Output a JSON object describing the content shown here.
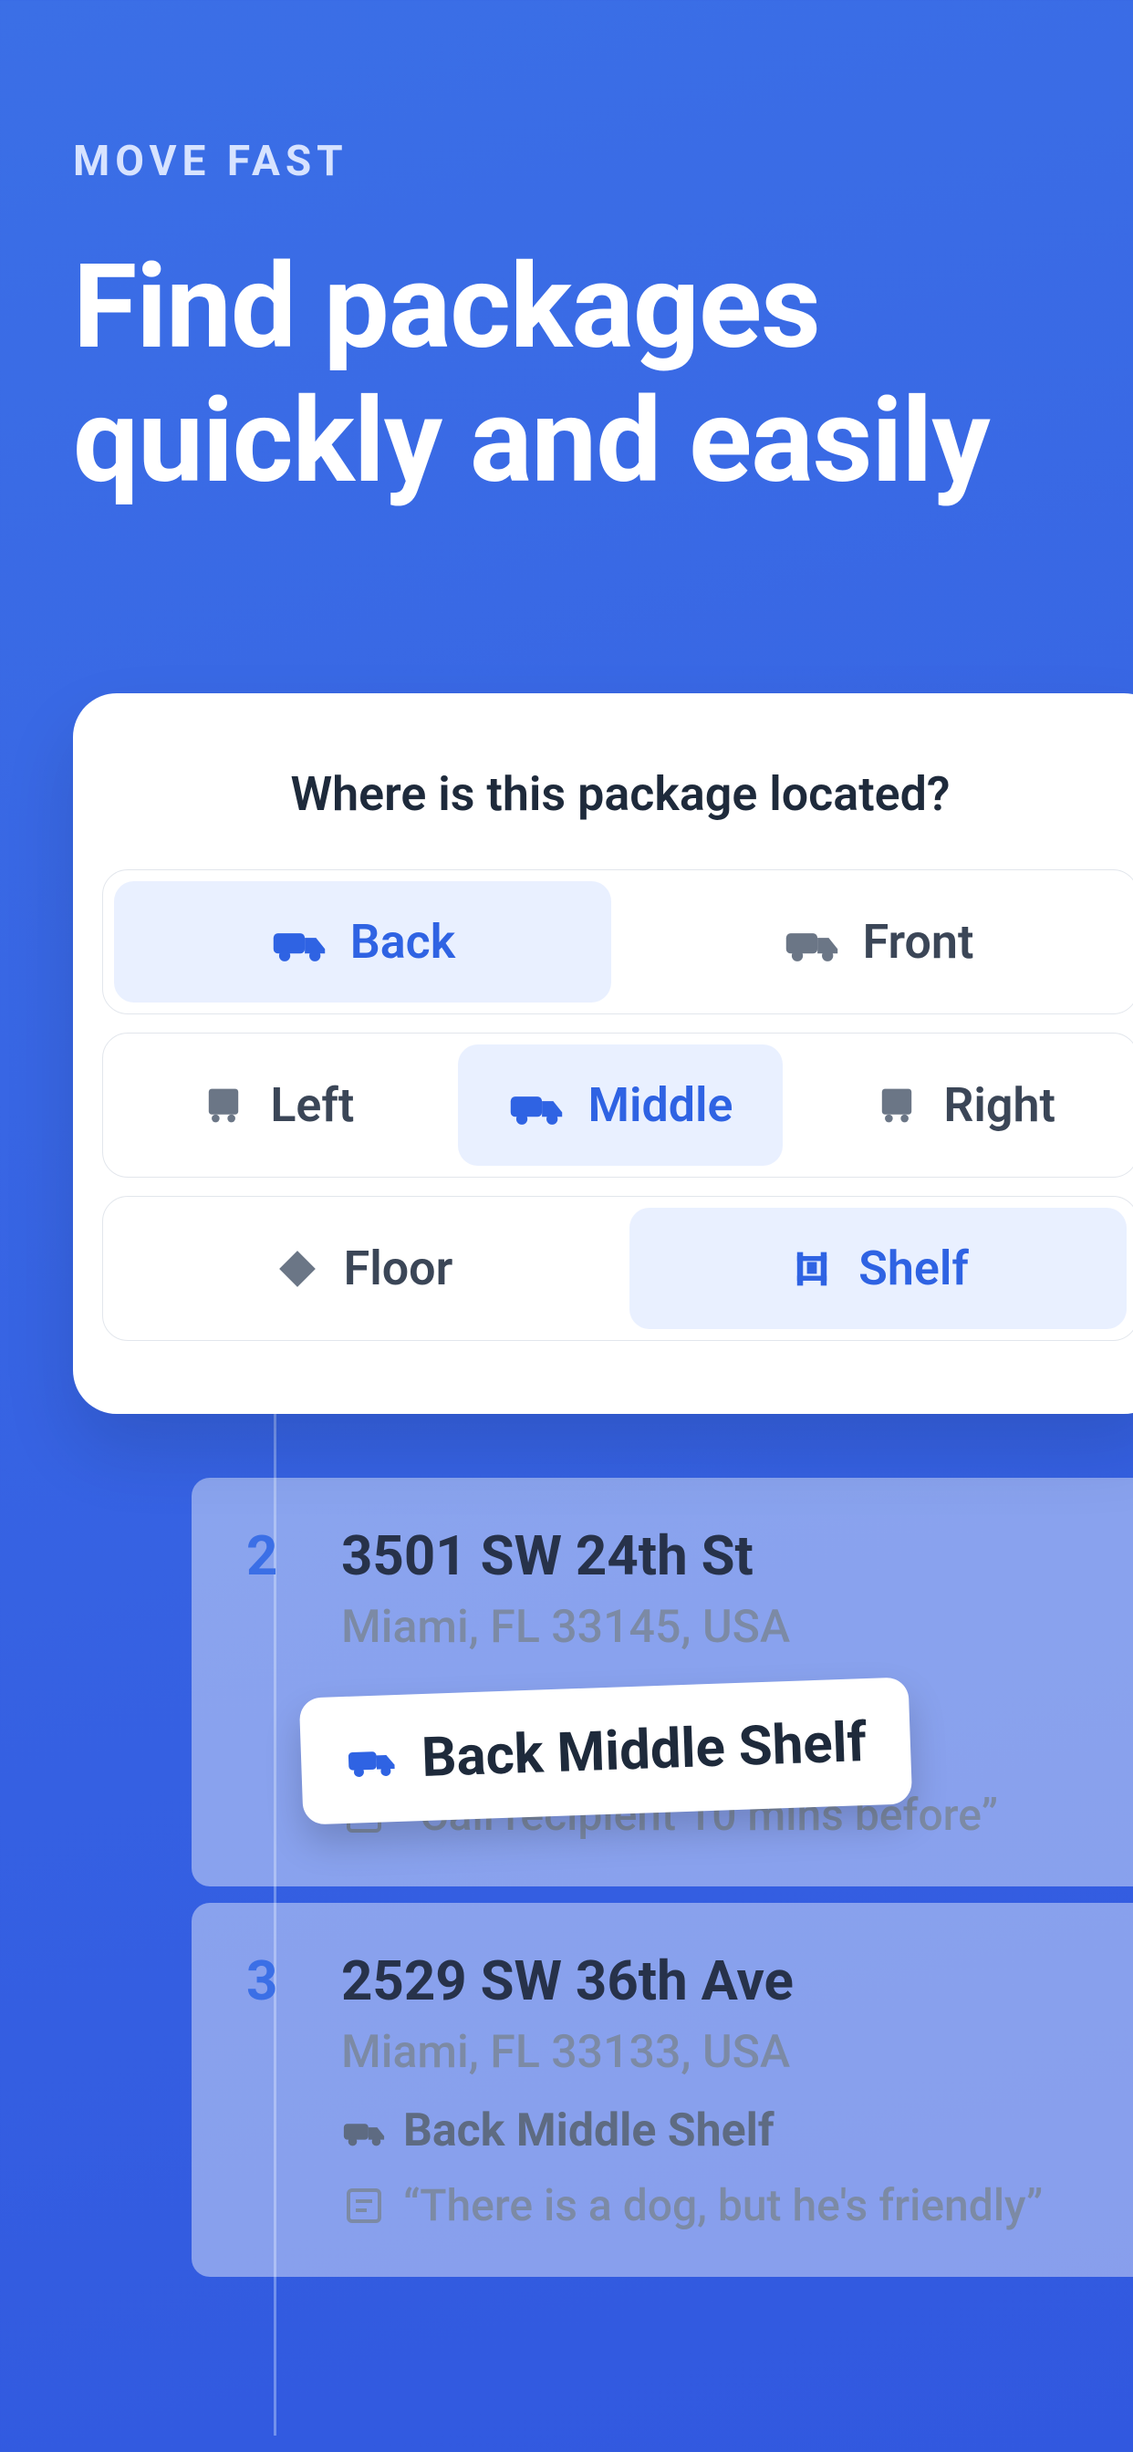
{
  "hero": {
    "eyebrow": "MOVE FAST",
    "headline_l1": "Find packages",
    "headline_l2": "quickly and easily"
  },
  "card": {
    "title": "Where is this package located?",
    "row1": [
      {
        "label": "Back",
        "icon": "truck-icon",
        "selected": true
      },
      {
        "label": "Front",
        "icon": "truck-icon",
        "selected": false
      }
    ],
    "row2": [
      {
        "label": "Left",
        "icon": "truck-rear-icon",
        "selected": false
      },
      {
        "label": "Middle",
        "icon": "truck-icon",
        "selected": true
      },
      {
        "label": "Right",
        "icon": "truck-rear-icon",
        "selected": false
      }
    ],
    "row3": [
      {
        "label": "Floor",
        "icon": "diamond-icon",
        "selected": false
      },
      {
        "label": "Shelf",
        "icon": "shelf-icon",
        "selected": true
      }
    ]
  },
  "popover": {
    "text": "Back Middle Shelf"
  },
  "stops": [
    {
      "num": "2",
      "line1": "3501 SW 24th St",
      "line2": "Miami, FL 33145, USA",
      "tag": "",
      "note": "Call recipient 10 mins before"
    },
    {
      "num": "3",
      "line1": "2529 SW 36th Ave",
      "line2": "Miami, FL 33133, USA",
      "tag": "Back Middle Shelf",
      "note": "There is a dog, but he's friendly"
    }
  ],
  "colors": {
    "primary": "#2F63E3"
  }
}
